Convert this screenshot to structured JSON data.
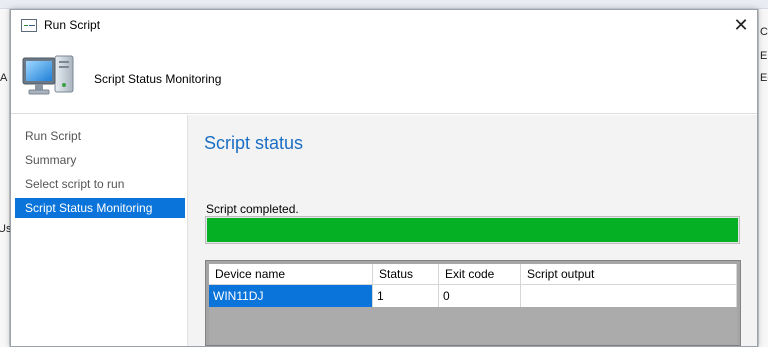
{
  "background_app": {
    "left_chars": [
      "A",
      "Us"
    ],
    "right_chars": [
      "Cl",
      "En",
      "Ed"
    ]
  },
  "dialog": {
    "title": "Run Script",
    "close_glyph": "✕",
    "header_text": "Script Status Monitoring"
  },
  "nav": {
    "items": [
      {
        "label": "Run Script",
        "active": false
      },
      {
        "label": "Summary",
        "active": false
      },
      {
        "label": "Select script to run",
        "active": false
      },
      {
        "label": "Script Status Monitoring",
        "active": true
      }
    ]
  },
  "main": {
    "section_title": "Script status",
    "status_text": "Script completed.",
    "progress_fraction": 1.0,
    "progress_color": "#06b025"
  },
  "table": {
    "columns": [
      "Device name",
      "Status",
      "Exit code",
      "Script output"
    ],
    "rows": [
      {
        "device": "WIN11DJ",
        "status": "1",
        "exit_code": "0",
        "output": ""
      }
    ]
  },
  "colors": {
    "accent": "#0a74da",
    "title_blue": "#1a6fc4"
  },
  "icons": {
    "title": "script-window-icon",
    "header": "computer-monitor-icon",
    "close": "close-icon"
  }
}
